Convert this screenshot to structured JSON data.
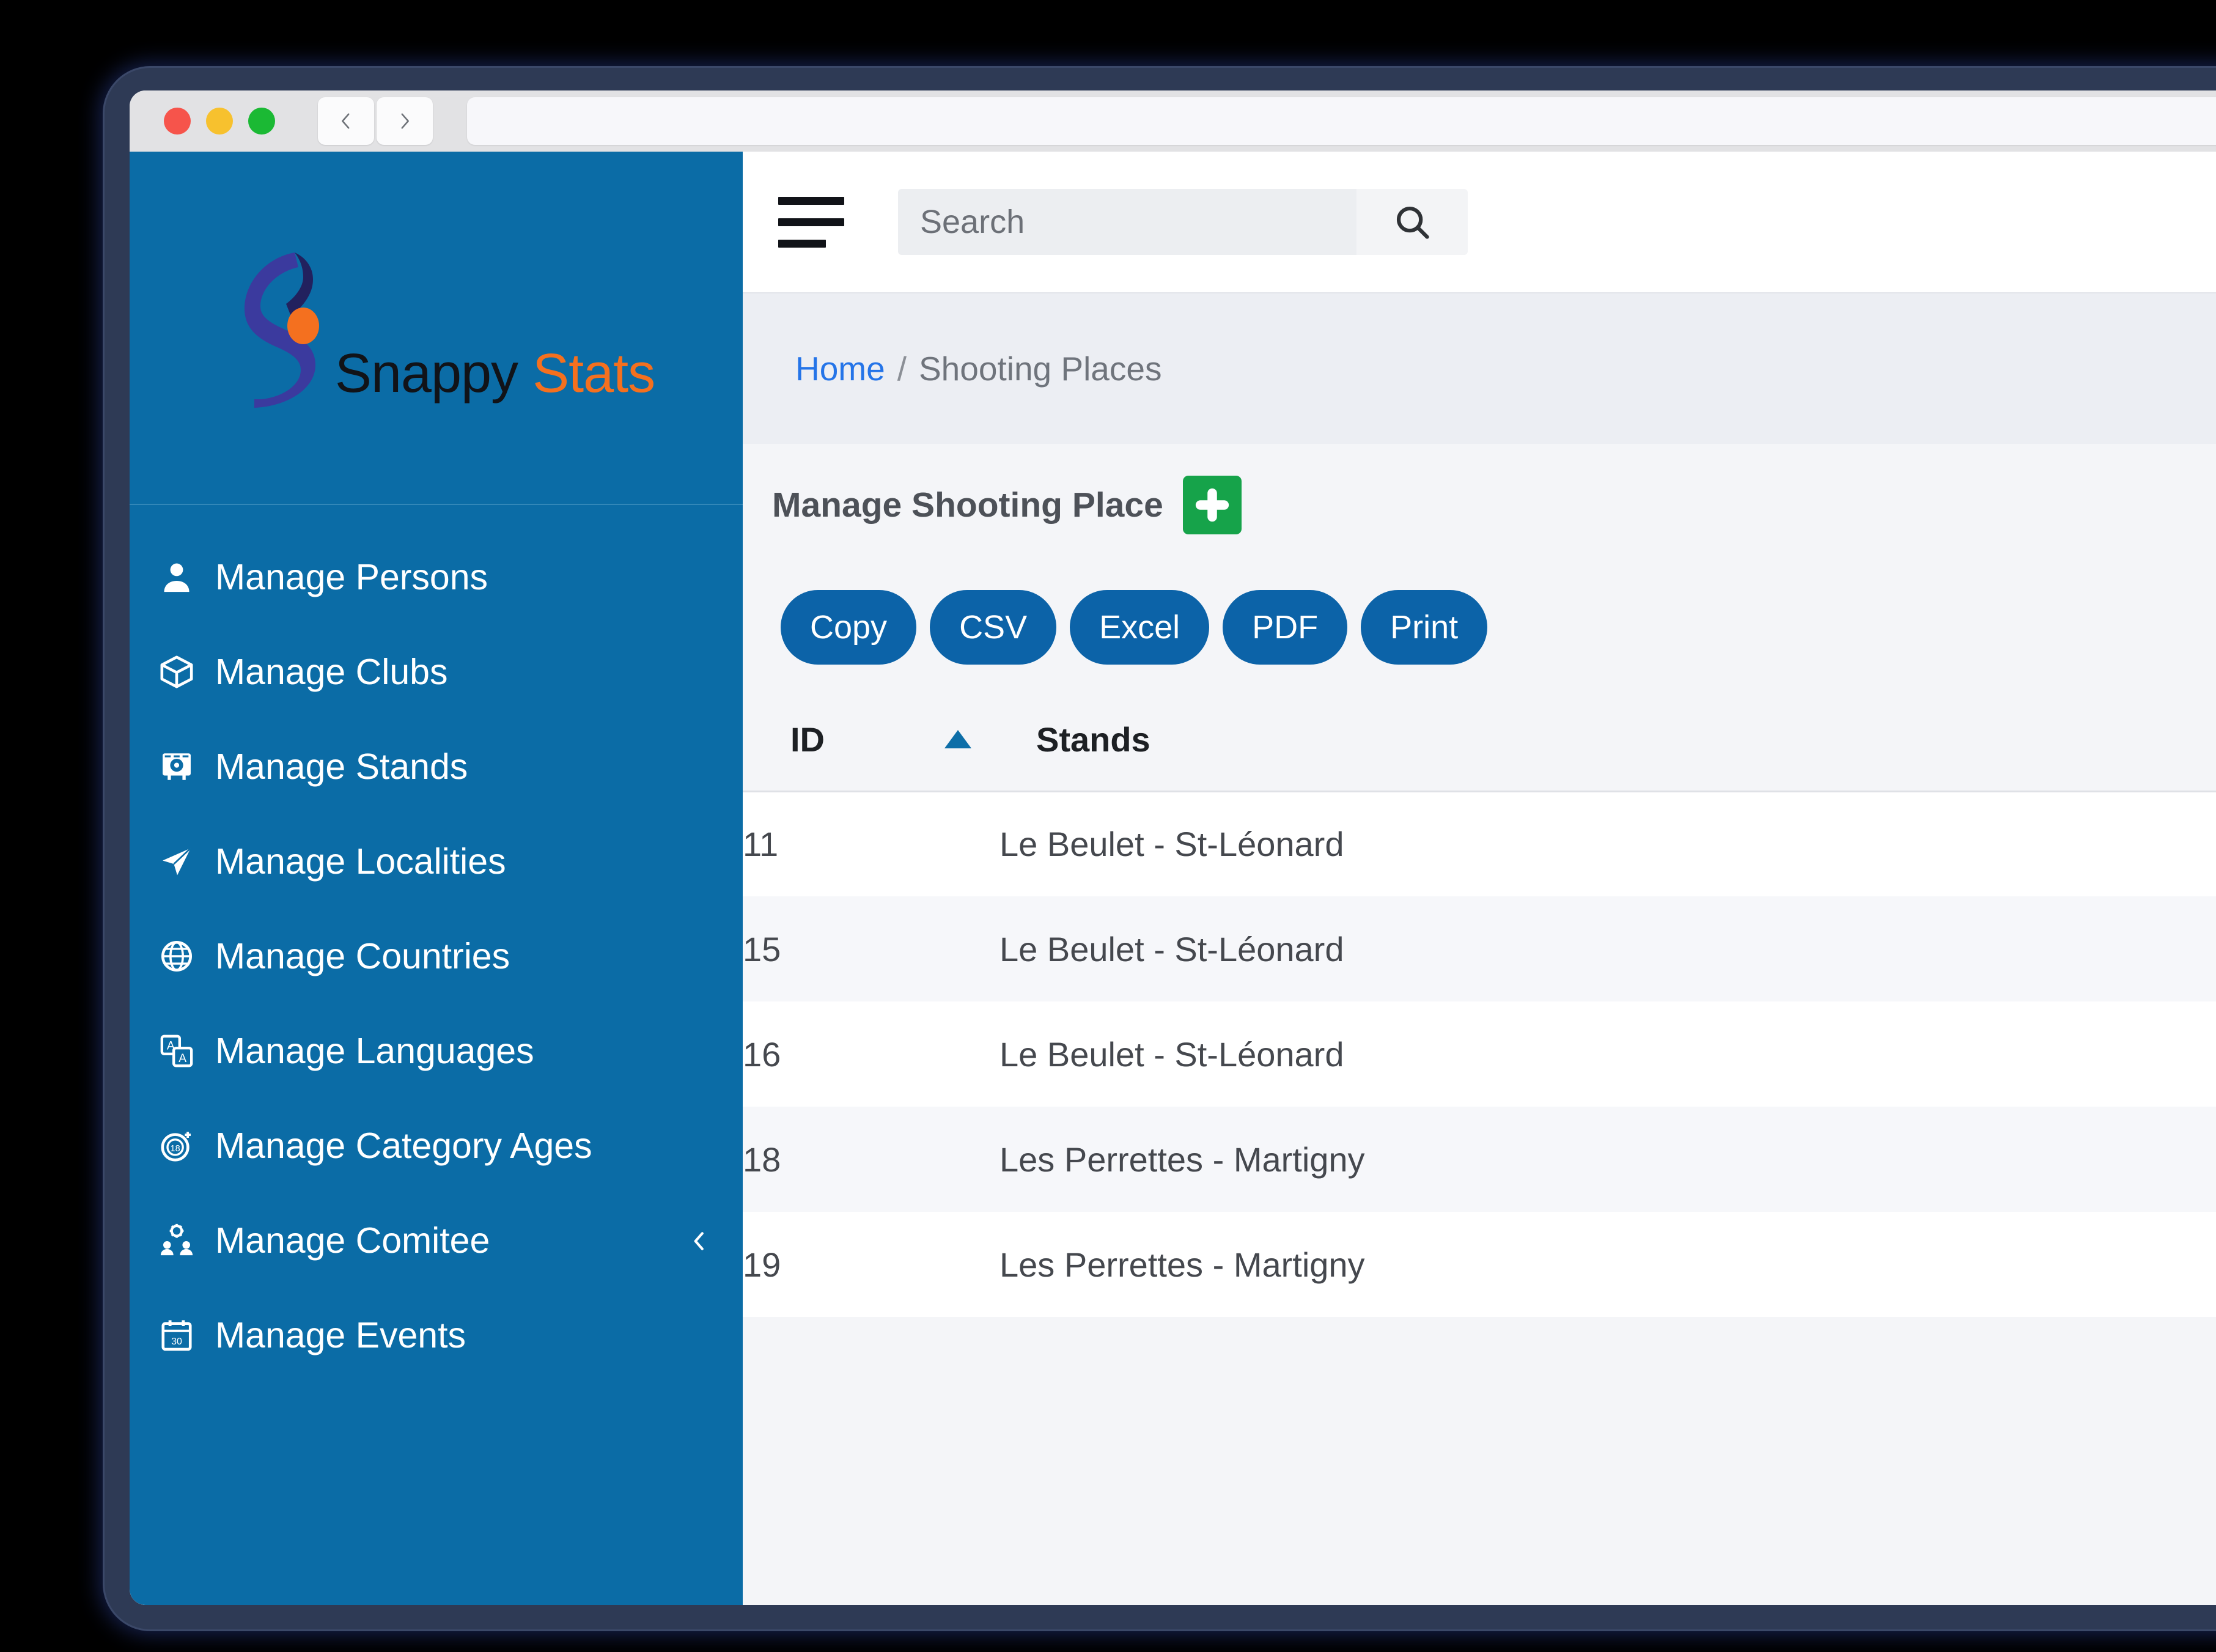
{
  "browser": {
    "traffic_lights": [
      "close",
      "minimize",
      "maximize"
    ],
    "back_label": "Back",
    "forward_label": "Forward",
    "url_value": "",
    "url_placeholder": ""
  },
  "brand": {
    "word1": "Snappy",
    "word2": "Stats",
    "word1_color": "#111318",
    "word2_color": "#f4701f",
    "logo_dot_color": "#f4701f",
    "logo_swoosh_color": "#3b3a9e"
  },
  "sidebar": {
    "background_color": "#0b6ca6",
    "items": [
      {
        "label": "Manage Persons",
        "icon": "user-icon",
        "name": "manage-persons"
      },
      {
        "label": "Manage Clubs",
        "icon": "cube-icon",
        "name": "manage-clubs"
      },
      {
        "label": "Manage Stands",
        "icon": "target-board-icon",
        "name": "manage-stands"
      },
      {
        "label": "Manage Localities",
        "icon": "paper-plane-icon",
        "name": "manage-localities"
      },
      {
        "label": "Manage Countries",
        "icon": "globe-icon",
        "name": "manage-countries"
      },
      {
        "label": "Manage Languages",
        "icon": "translate-icon",
        "name": "manage-languages"
      },
      {
        "label": "Manage Category Ages",
        "icon": "age-badge-icon",
        "name": "manage-category-ages"
      },
      {
        "label": "Manage Comitee",
        "icon": "people-gear-icon",
        "name": "manage-comitee",
        "chevron": "chevron-left-icon"
      },
      {
        "label": "Manage Events",
        "icon": "calendar-icon",
        "name": "manage-events"
      }
    ]
  },
  "topbar": {
    "menu_toggle": "hamburger-icon",
    "search_placeholder": "Search",
    "search_value": "",
    "search_button_icon": "search-icon"
  },
  "breadcrumb": {
    "home": "Home",
    "separator": "/",
    "current": "Shooting Places"
  },
  "page": {
    "title": "Manage Shooting Place",
    "add_button_label": "+",
    "add_button_color": "#16a34a"
  },
  "export_buttons": {
    "color": "#0c63a8",
    "items": [
      "Copy",
      "CSV",
      "Excel",
      "PDF",
      "Print"
    ]
  },
  "table": {
    "columns": [
      "ID",
      "Stands"
    ],
    "sort_column": "ID",
    "sort_direction": "asc",
    "sort_indicator_color": "#0d6ea8",
    "rows": [
      {
        "id": "11",
        "stands": "Le Beulet - St-Léonard"
      },
      {
        "id": "15",
        "stands": "Le Beulet - St-Léonard"
      },
      {
        "id": "16",
        "stands": "Le Beulet - St-Léonard"
      },
      {
        "id": "18",
        "stands": "Les Perrettes - Martigny"
      },
      {
        "id": "19",
        "stands": "Les Perrettes - Martigny"
      }
    ]
  }
}
